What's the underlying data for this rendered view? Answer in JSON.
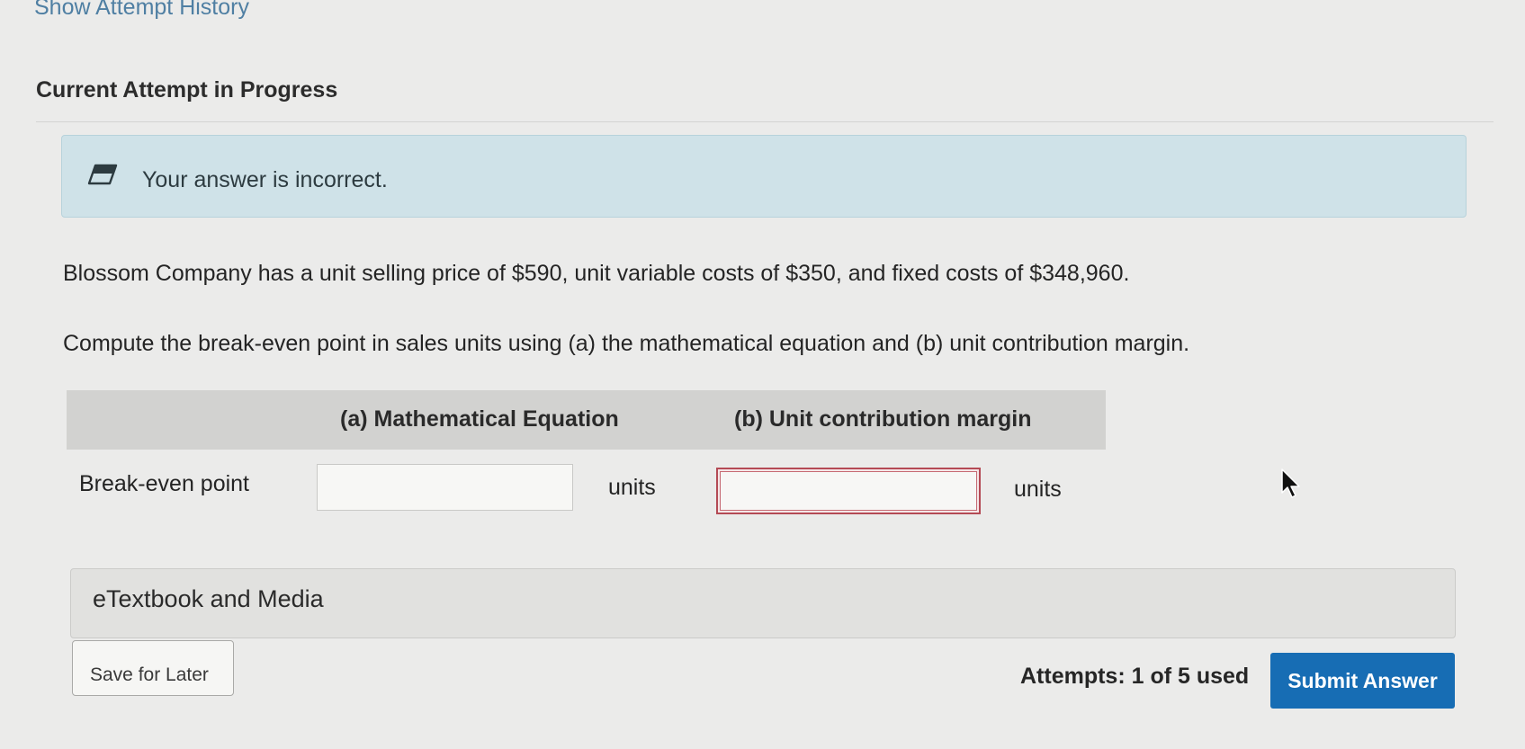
{
  "header": {
    "history_link": "Show Attempt History",
    "attempt_title": "Current Attempt in Progress"
  },
  "feedback": {
    "icon": "eraser-icon",
    "message": "Your answer is incorrect."
  },
  "question": {
    "line1": "Blossom Company has a unit selling price of $590, unit variable costs of $350, and fixed costs of $348,960.",
    "line2": "Compute the break-even point in sales units using (a) the mathematical equation and (b) unit contribution margin."
  },
  "table": {
    "col_a": "(a) Mathematical Equation",
    "col_b": "(b) Unit contribution margin",
    "row_label": "Break-even point",
    "input_a_value": "",
    "input_b_value": "",
    "unit_a": "units",
    "unit_b": "units"
  },
  "etextbook": {
    "label": "eTextbook and Media"
  },
  "footer": {
    "save_label": "Save for Later",
    "attempts_text": "Attempts: 1 of 5 used",
    "submit_label": "Submit Answer"
  },
  "colors": {
    "page_background": "#ebebea",
    "link": "#4f7fa3",
    "feedback_background": "#cfe2e8",
    "table_header": "#d2d2d0",
    "error_border": "#b44a55",
    "submit_button": "#176db4"
  },
  "icons": [
    "eraser-icon",
    "mouse-pointer-icon"
  ]
}
